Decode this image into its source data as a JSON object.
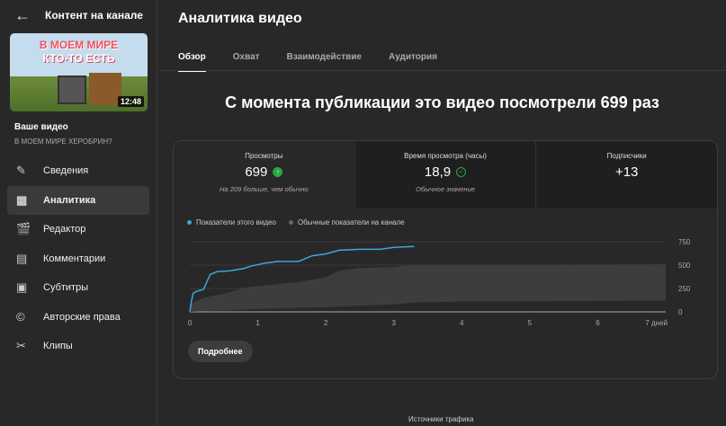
{
  "sidebar": {
    "title": "Контент на канале",
    "thumbnail": {
      "line1": "В МОЕМ МИРЕ",
      "line2": "КТО-ТО ЕСТЬ",
      "duration": "12:48"
    },
    "your_video": "Ваше видео",
    "video_title": "В МОЕМ МИРЕ ХЕРОБРИН?",
    "items": [
      {
        "label": "Сведения",
        "icon": "pencil-icon"
      },
      {
        "label": "Аналитика",
        "icon": "analytics-icon",
        "active": true
      },
      {
        "label": "Редактор",
        "icon": "editor-icon"
      },
      {
        "label": "Комментарии",
        "icon": "comments-icon"
      },
      {
        "label": "Субтитры",
        "icon": "subtitles-icon"
      },
      {
        "label": "Авторские права",
        "icon": "copyright-icon"
      },
      {
        "label": "Клипы",
        "icon": "scissors-icon"
      }
    ]
  },
  "main": {
    "title": "Аналитика видео",
    "tabs": [
      "Обзор",
      "Охват",
      "Взаимодействие",
      "Аудитория"
    ],
    "headline": "С момента публикации это видео посмотрели 699 раз",
    "metrics": [
      {
        "label": "Просмотры",
        "value": "699",
        "sub": "На 209 больше, чем обычно"
      },
      {
        "label": "Время просмотра (часы)",
        "value": "18,9",
        "sub": "Обычное значение"
      },
      {
        "label": "Подписчики",
        "value": "+13",
        "sub": ""
      }
    ],
    "more_button": "Подробнее",
    "next_section": "Источники трафика"
  },
  "chart_data": {
    "type": "line",
    "legend": [
      "Показатели этого видео",
      "Обычные показатели на канале"
    ],
    "colors": {
      "video": "#3ea6d8",
      "band": "#3d3d3d"
    },
    "x_ticks": [
      "0",
      "1",
      "2",
      "3",
      "4",
      "5",
      "6",
      "7 дней"
    ],
    "y_ticks": [
      "0",
      "250",
      "500",
      "750"
    ],
    "xlim": [
      0,
      7
    ],
    "ylim": [
      0,
      750
    ],
    "video_series": [
      [
        0,
        0
      ],
      [
        0.02,
        100
      ],
      [
        0.05,
        200
      ],
      [
        0.1,
        220
      ],
      [
        0.2,
        240
      ],
      [
        0.3,
        400
      ],
      [
        0.4,
        430
      ],
      [
        0.6,
        440
      ],
      [
        0.8,
        465
      ],
      [
        0.9,
        490
      ],
      [
        1.1,
        520
      ],
      [
        1.3,
        540
      ],
      [
        1.6,
        540
      ],
      [
        1.8,
        600
      ],
      [
        2,
        620
      ],
      [
        2.2,
        660
      ],
      [
        2.5,
        670
      ],
      [
        2.8,
        670
      ],
      [
        3,
        690
      ],
      [
        3.3,
        699
      ]
    ],
    "typical_upper": [
      [
        0,
        80
      ],
      [
        0.2,
        150
      ],
      [
        0.4,
        180
      ],
      [
        0.6,
        210
      ],
      [
        0.8,
        260
      ],
      [
        1.2,
        290
      ],
      [
        1.6,
        320
      ],
      [
        2,
        370
      ],
      [
        2.2,
        440
      ],
      [
        2.5,
        470
      ],
      [
        3,
        480
      ],
      [
        3.2,
        500
      ],
      [
        4,
        500
      ],
      [
        7,
        510
      ]
    ],
    "typical_lower": [
      [
        0,
        0
      ],
      [
        1,
        30
      ],
      [
        2,
        50
      ],
      [
        3,
        80
      ],
      [
        3.3,
        100
      ],
      [
        4,
        110
      ],
      [
        7,
        120
      ]
    ]
  }
}
